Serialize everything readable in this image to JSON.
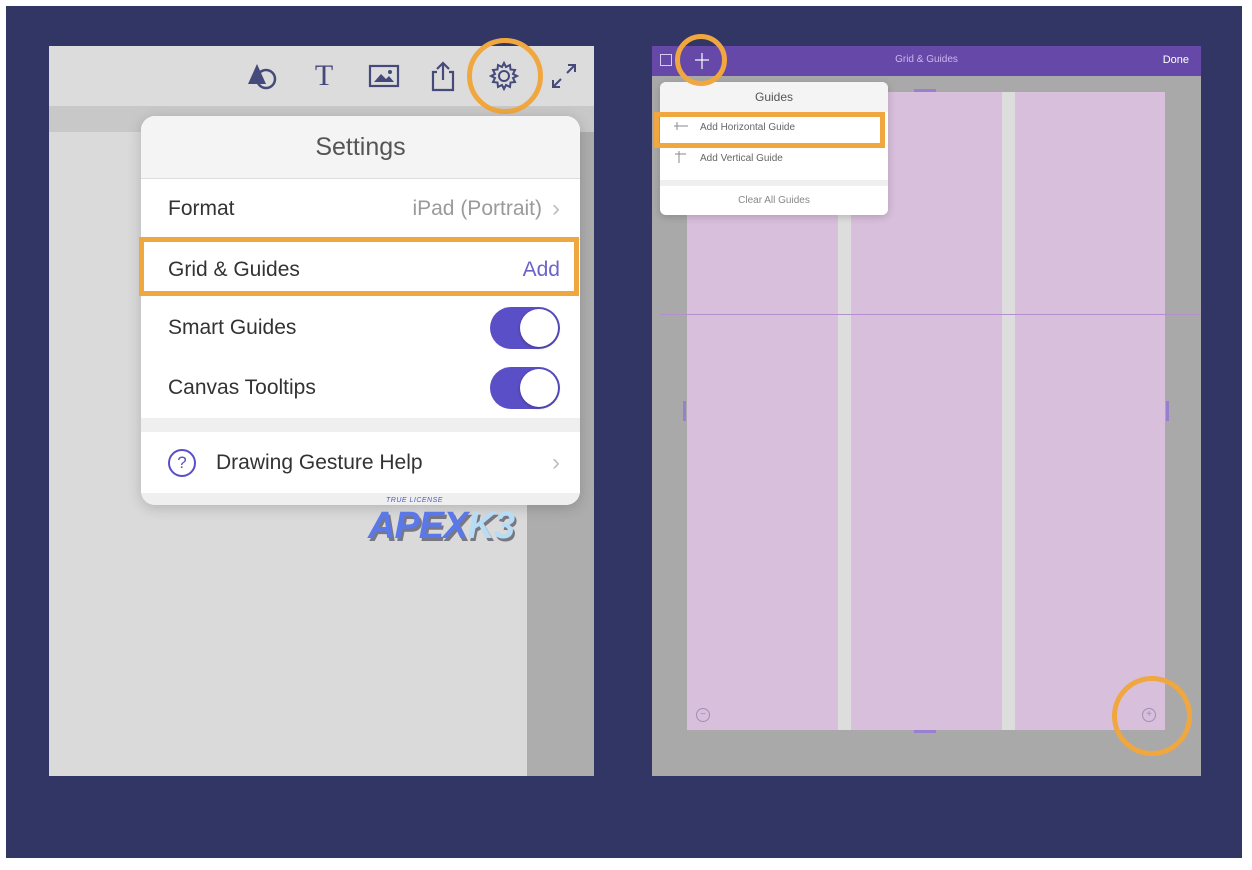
{
  "left_panel": {
    "toolbar_icons": [
      "shapes-icon",
      "text-icon",
      "image-icon",
      "share-icon",
      "settings-gear-icon",
      "fullscreen-expand-icon"
    ],
    "text_tool_glyph": "T",
    "settings": {
      "title": "Settings",
      "format": {
        "label": "Format",
        "value": "iPad (Portrait)"
      },
      "grid_guides": {
        "label": "Grid & Guides",
        "action": "Add"
      },
      "smart_guides": {
        "label": "Smart Guides",
        "enabled": true
      },
      "canvas_tooltips": {
        "label": "Canvas Tooltips",
        "enabled": true
      },
      "help": {
        "label": "Drawing Gesture Help",
        "icon_glyph": "?"
      }
    },
    "chevron": "›"
  },
  "watermark": {
    "small": "TRUE LICENSE",
    "big_a": "APEX",
    "big_b": "K3"
  },
  "right_panel": {
    "title": "Grid & Guides",
    "done_label": "Done",
    "guides_menu": {
      "title": "Guides",
      "add_horizontal": "Add Horizontal Guide",
      "add_vertical": "Add Vertical Guide",
      "clear_all": "Clear All Guides"
    },
    "zoom_out_glyph": "−",
    "zoom_in_glyph": "+"
  },
  "colors": {
    "background": "#313665",
    "highlight": "#f0a73f",
    "accent": "#5a4fc7",
    "topbar": "#6648a8",
    "artboard": "#d8bfdb"
  }
}
